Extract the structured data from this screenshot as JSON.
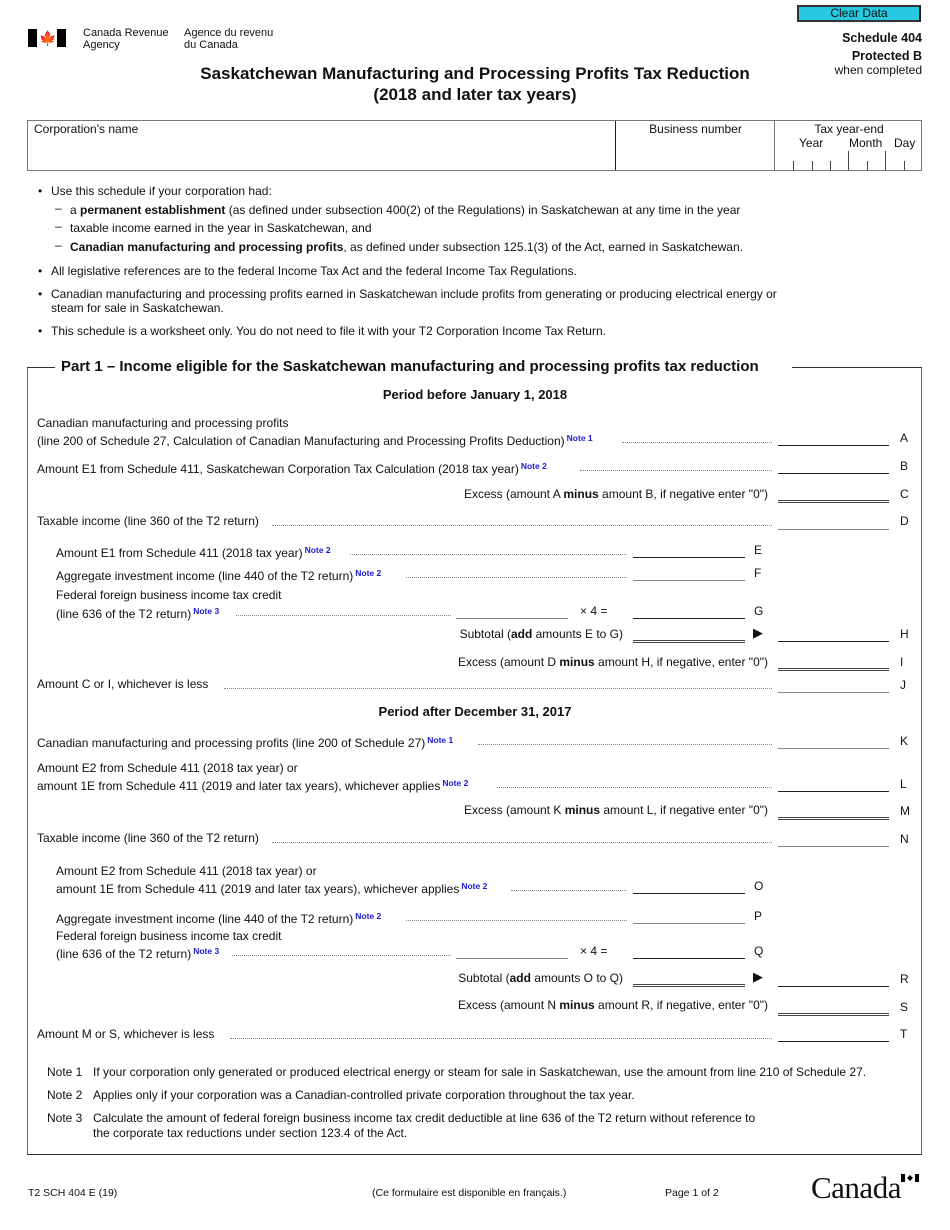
{
  "header": {
    "agency_en_1": "Canada Revenue",
    "agency_en_2": "Agency",
    "agency_fr_1": "Agence du revenu",
    "agency_fr_2": "du Canada",
    "clear_button": "Clear Data",
    "schedule": "Schedule 404",
    "protected": "Protected B",
    "when_completed": "when completed",
    "title_1": "Saskatchewan Manufacturing and Processing Profits Tax Reduction",
    "title_2": "(2018 and later tax years)"
  },
  "id_box": {
    "corp_name_label": "Corporation's name",
    "corp_name_value": "",
    "business_number_label": "Business number",
    "business_number_value": "",
    "tax_year_end_label": "Tax year-end",
    "year_label": "Year",
    "month_label": "Month",
    "day_label": "Day"
  },
  "intro": {
    "b1": "Use this schedule if your corporation had:",
    "d1_pre": "a ",
    "d1_bold": "permanent establishment",
    "d1_post": " (as defined under subsection 400(2) of the Regulations) in Saskatchewan at any time in the year",
    "d2": "taxable income earned in the year in Saskatchewan, and",
    "d3_bold": "Canadian manufacturing and processing profits",
    "d3_post": ", as defined under subsection 125.1(3) of the Act, earned in Saskatchewan.",
    "b2": "All legislative references are to the federal Income Tax Act and the federal Income Tax Regulations.",
    "b3_1": "Canadian manufacturing and processing profits earned in Saskatchewan include profits from generating or producing electrical energy or",
    "b3_2": "steam for sale in Saskatchewan.",
    "b4": "This schedule is a worksheet only. You do not need to file it with your T2 Corporation Income Tax Return."
  },
  "part1": {
    "title": "Part 1 – Income eligible for the Saskatchewan manufacturing and processing profits tax reduction",
    "period_before": "Period before January 1, 2018",
    "period_after": "Period after December 31, 2017",
    "multiplier": "×   4   =",
    "arrow": "▶",
    "lines": {
      "A1": "Canadian manufacturing and processing profits",
      "A2": "(line 200 of Schedule 27, Calculation of Canadian Manufacturing and Processing Profits Deduction)",
      "A_note": "Note 1",
      "B": "Amount E1 from Schedule 411, Saskatchewan Corporation Tax Calculation (2018 tax year)",
      "B_note": "Note 2",
      "C_pre": "Excess (amount A ",
      "C_bold": "minus",
      "C_post": " amount B, if negative enter \"0\")",
      "D": "Taxable income (line 360 of the T2 return)",
      "E": "Amount E1 from Schedule 411 (2018 tax year)",
      "E_note": "Note 2",
      "F": "Aggregate investment income (line 440 of the T2 return)",
      "F_note": "Note 2",
      "G1": "Federal foreign business income tax credit",
      "G2": "(line 636 of the T2 return)",
      "G_note": "Note 3",
      "H_pre": "Subtotal (",
      "H_bold": "add",
      "H_post": " amounts E to G)",
      "I_pre": "Excess (amount D ",
      "I_bold": "minus",
      "I_post": " amount H, if negative, enter \"0\")",
      "J": "Amount C or I, whichever is less",
      "K": "Canadian manufacturing and processing profits (line 200 of Schedule 27)",
      "K_note": "Note 1",
      "L1": "Amount E2 from Schedule 411 (2018 tax year) or",
      "L2": "amount 1E from Schedule 411 (2019 and later tax years), whichever applies",
      "L_note": "Note 2",
      "M_pre": "Excess (amount K ",
      "M_bold": "minus",
      "M_post": " amount L, if negative enter \"0\")",
      "N": "Taxable income (line 360 of the T2 return)",
      "O1": "Amount E2 from Schedule 411 (2018 tax year) or",
      "O2": "amount 1E from Schedule 411 (2019 and later tax years), whichever applies",
      "O_note": "Note 2",
      "P": "Aggregate investment income (line 440 of the T2 return)",
      "P_note": "Note 2",
      "Q1": "Federal foreign business income tax credit",
      "Q2": "(line 636 of the T2 return)",
      "Q_note": "Note 3",
      "R_pre": "Subtotal (",
      "R_bold": "add",
      "R_post": " amounts O to Q)",
      "S_pre": "Excess (amount N ",
      "S_bold": "minus",
      "S_post": " amount R, if negative, enter \"0\")",
      "T": "Amount M or S, whichever is less"
    },
    "letters": [
      "A",
      "B",
      "C",
      "D",
      "E",
      "F",
      "G",
      "H",
      "I",
      "J",
      "K",
      "L",
      "M",
      "N",
      "O",
      "P",
      "Q",
      "R",
      "S",
      "T"
    ]
  },
  "notes": [
    {
      "label": "Note 1",
      "text": "If your corporation only generated or produced electrical energy or steam for sale in Saskatchewan, use the amount from line 210 of Schedule 27."
    },
    {
      "label": "Note 2",
      "text": "Applies only if your corporation was a Canadian-controlled private corporation throughout the tax year."
    },
    {
      "label": "Note 3",
      "text_1": "Calculate the amount of federal foreign business income tax credit deductible at line 636 of the T2 return without reference to",
      "text_2": "the corporate tax reductions under section 123.4 of the Act."
    }
  ],
  "footer": {
    "form_code": "T2 SCH 404 E (19)",
    "french": "(Ce formulaire est disponible en français.)",
    "page": "Page 1 of 2",
    "wordmark": "Canada"
  }
}
